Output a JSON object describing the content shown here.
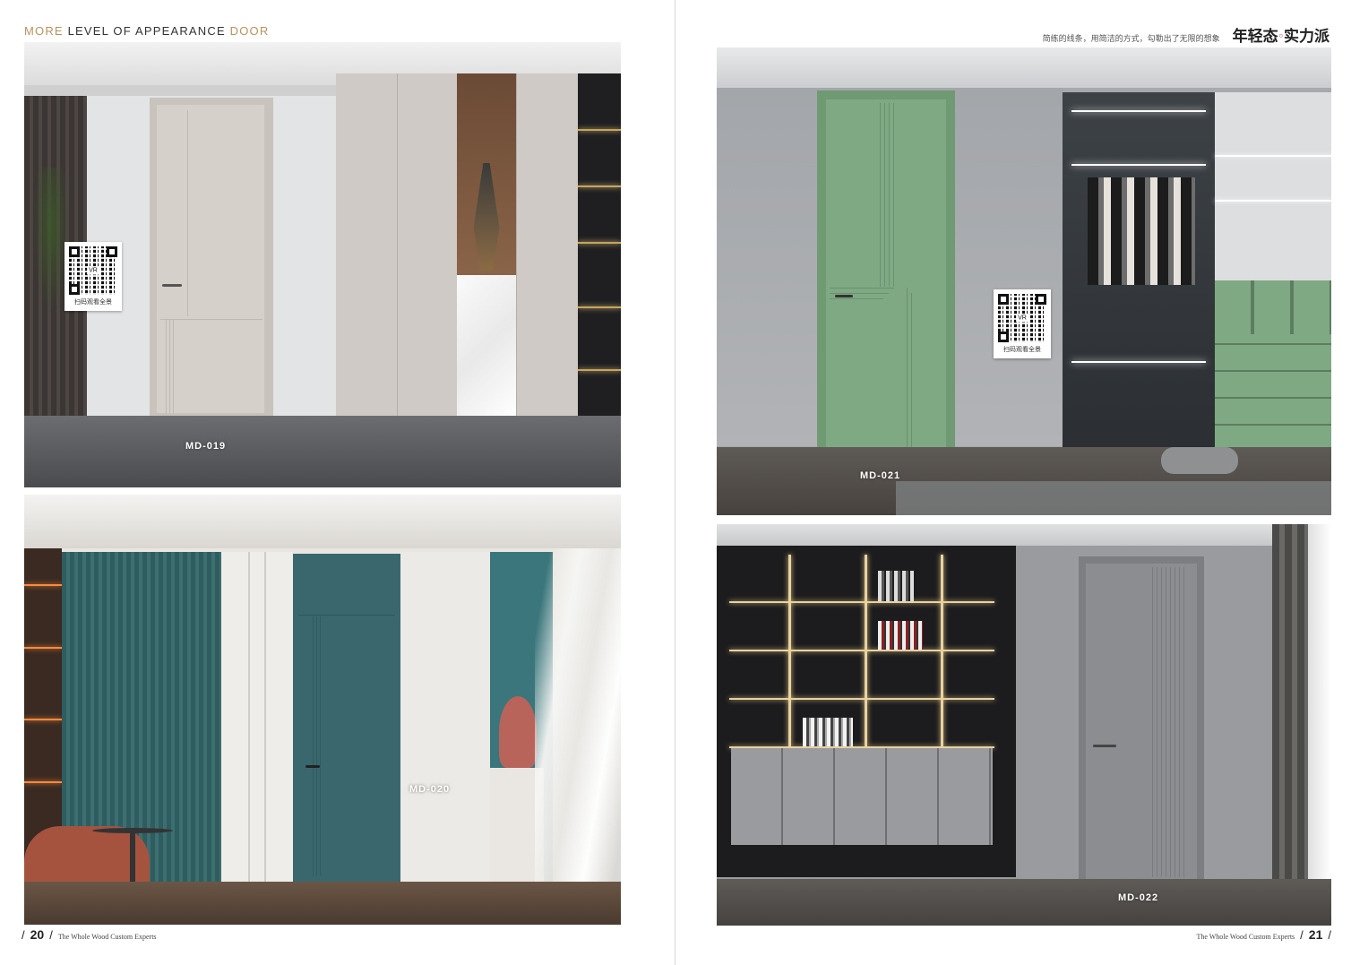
{
  "left_page": {
    "header": {
      "word1": "MORE",
      "word2": "LEVEL OF APPEARANCE",
      "word3": "DOOR"
    },
    "panels": [
      {
        "model": "MD-019"
      },
      {
        "model": "MD-020"
      }
    ],
    "qr": {
      "vr": "VR",
      "caption": "扫码观看全景"
    },
    "footer": {
      "page": "20",
      "text": "The Whole Wood Custom Experts"
    }
  },
  "right_page": {
    "header": {
      "tagline": "简练的线条，用简洁的方式，勾勒出了无限的想象",
      "slogan_part1": "年轻态",
      "slogan_part2": "实力派"
    },
    "panels": [
      {
        "model": "MD-021"
      },
      {
        "model": "MD-022"
      }
    ],
    "qr": {
      "vr": "VR",
      "caption": "扫码观看全景"
    },
    "footer": {
      "page": "21",
      "text": "The Whole Wood Custom Experts"
    }
  },
  "colors": {
    "gold_accent": "#b9935a",
    "door_019": "#d6d0cb",
    "door_020": "#3f6f76",
    "door_021": "#7fa983",
    "door_022": "#8c8d90"
  }
}
